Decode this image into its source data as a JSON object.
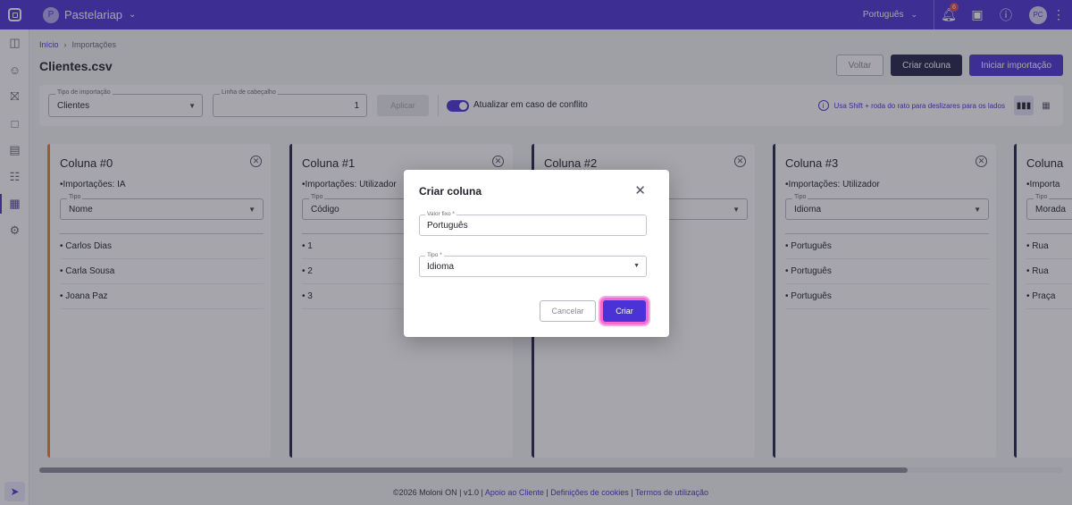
{
  "topbar": {
    "company_initial": "P",
    "company_name": "Pastelariap",
    "language": "Português",
    "notifications_count": "6",
    "user_initials": "PC"
  },
  "breadcrumb": {
    "home": "Início",
    "current": "Importações"
  },
  "page": {
    "title": "Clientes.csv"
  },
  "actions": {
    "back": "Voltar",
    "create_column": "Criar coluna",
    "start_import": "Iniciar importação"
  },
  "filters": {
    "import_type_label": "Tipo de importação",
    "import_type_value": "Clientes",
    "header_row_label": "Linha de cabeçalho",
    "header_row_value": "1",
    "apply": "Aplicar",
    "conflict_toggle_label": "Atualizar em caso de conflito",
    "hint": "Usa Shift + roda do rato para deslizares para os lados"
  },
  "columns": [
    {
      "title": "Coluna #0",
      "source": "•Importações: IA",
      "type_label": "Tipo",
      "type_value": "Nome",
      "rows": [
        "• Carlos Dias",
        "• Carla Sousa",
        "• Joana Paz"
      ]
    },
    {
      "title": "Coluna #1",
      "source": "•Importações: Utilizador",
      "type_label": "Tipo",
      "type_value": "Código",
      "rows": [
        "• 1",
        "• 2",
        "• 3"
      ]
    },
    {
      "title": "Coluna #2",
      "source": "",
      "type_label": "",
      "type_value": "",
      "rows": []
    },
    {
      "title": "Coluna #3",
      "source": "•Importações: Utilizador",
      "type_label": "Tipo",
      "type_value": "Idioma",
      "rows": [
        "• Português",
        "• Português",
        "• Português"
      ]
    },
    {
      "title": "Coluna",
      "source": "•Importa",
      "type_label": "Tipo",
      "type_value": "Morada",
      "rows": [
        "• Rua",
        "• Rua",
        "• Praça"
      ]
    }
  ],
  "footer": {
    "copyright": "©2026 Moloni ON",
    "version": "v1.0",
    "support": "Apoio ao Cliente",
    "cookies": "Definições de cookies",
    "terms": "Termos de utilização"
  },
  "modal": {
    "title": "Criar coluna",
    "fixed_value_label": "Valor fixo *",
    "fixed_value": "Português",
    "type_label": "Tipo *",
    "type_value": "Idioma",
    "cancel": "Cancelar",
    "create": "Criar"
  },
  "colors": {
    "primary": "#4a32d6",
    "dark": "#23234a",
    "highlight": "#f26ad2"
  }
}
